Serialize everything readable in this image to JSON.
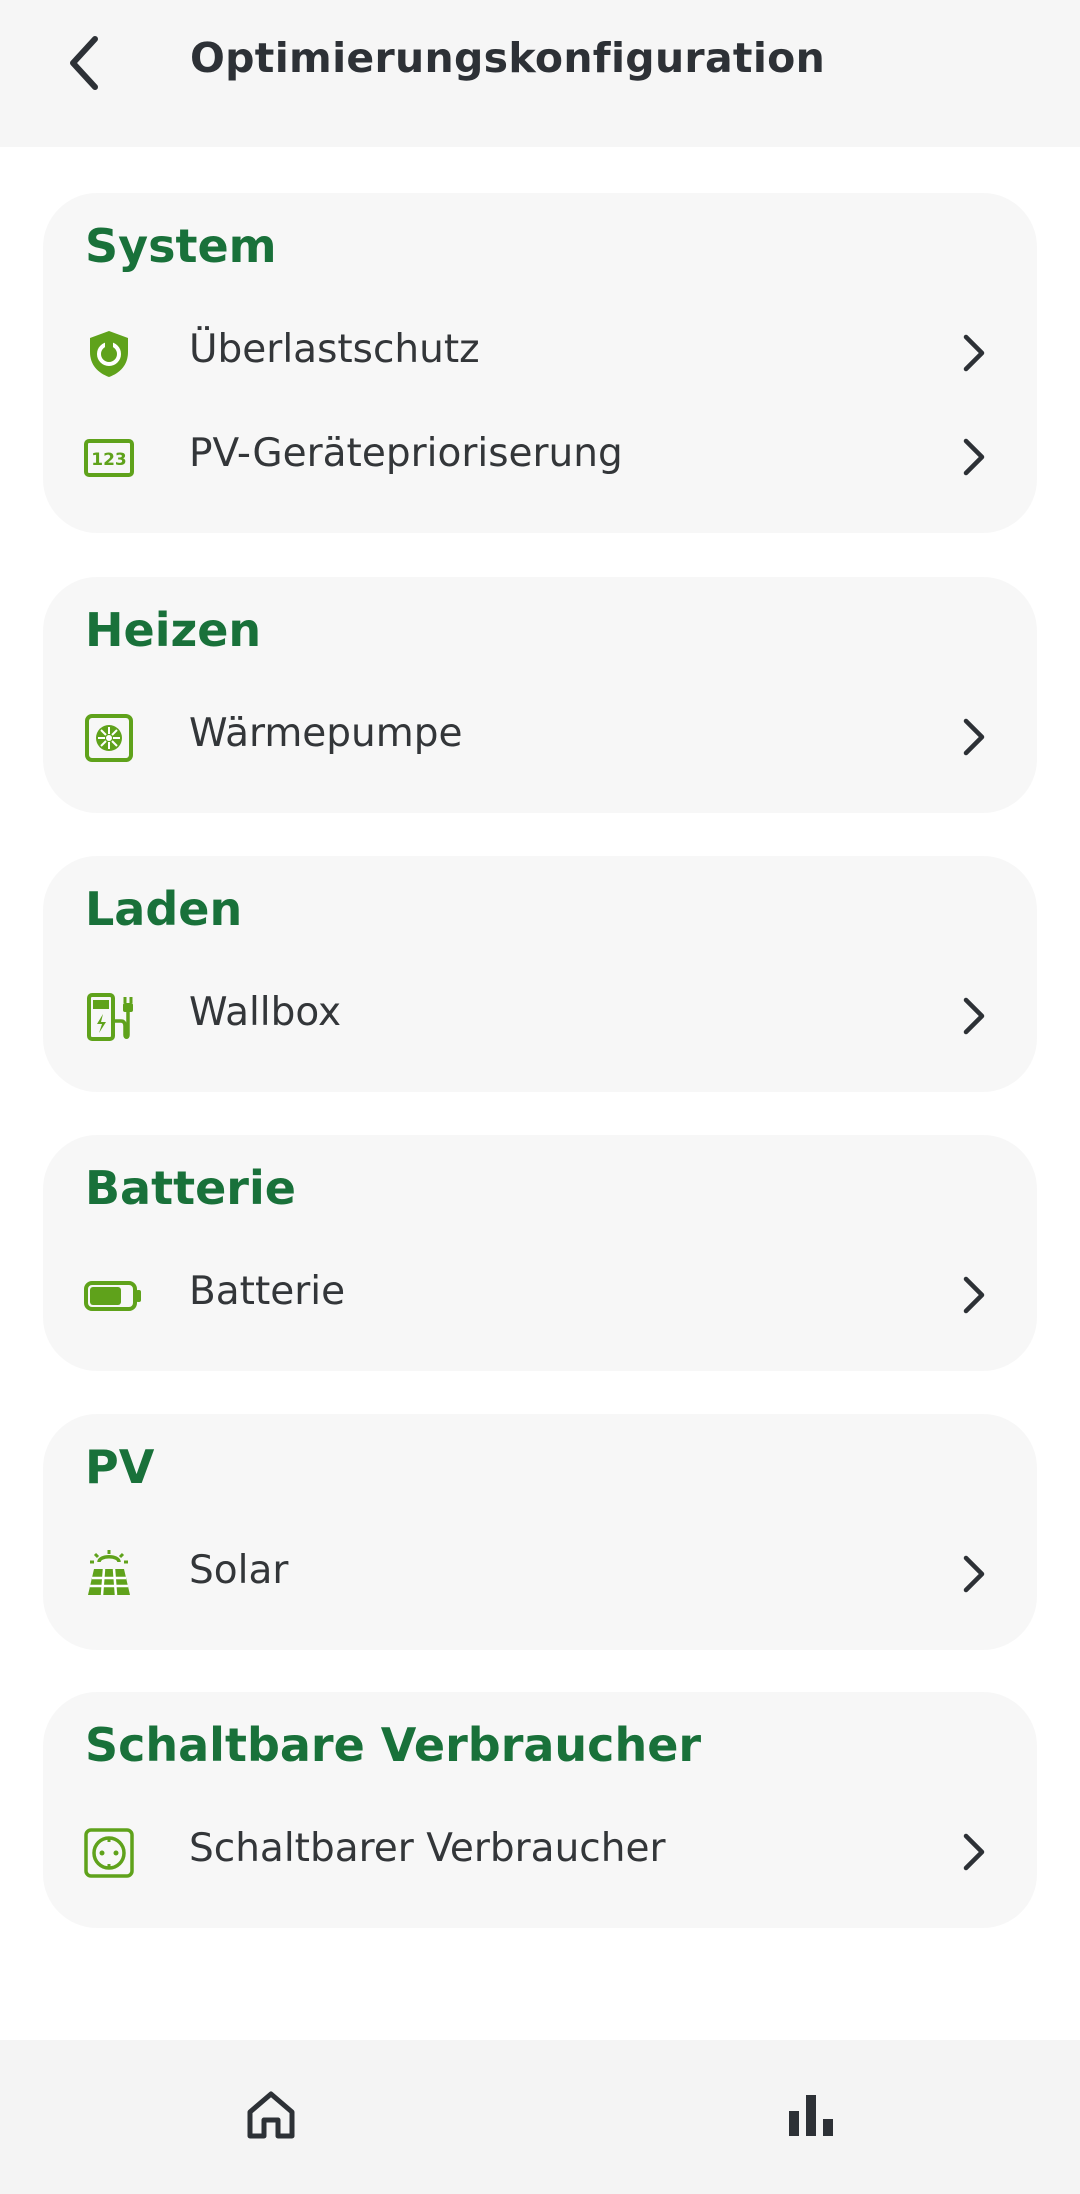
{
  "header": {
    "title": "Optimierungskonfiguration",
    "back_icon": "arrow-left-icon"
  },
  "sections": [
    {
      "title": "System",
      "items": [
        {
          "label": "Überlastschutz",
          "icon": "shield-icon"
        },
        {
          "label": "PV-Geräteprioriserung",
          "icon": "numbers-123-icon"
        }
      ]
    },
    {
      "title": "Heizen",
      "items": [
        {
          "label": "Wärmepumpe",
          "icon": "heat-pump-icon"
        }
      ]
    },
    {
      "title": "Laden",
      "items": [
        {
          "label": "Wallbox",
          "icon": "ev-charger-icon"
        }
      ]
    },
    {
      "title": "Batterie",
      "items": [
        {
          "label": "Batterie",
          "icon": "battery-icon"
        }
      ]
    },
    {
      "title": "PV",
      "items": [
        {
          "label": "Solar",
          "icon": "solar-panel-icon"
        }
      ]
    },
    {
      "title": "Schaltbare Verbraucher",
      "items": [
        {
          "label": "Schaltbarer Verbraucher",
          "icon": "power-socket-icon"
        }
      ]
    }
  ],
  "bottom_nav": {
    "items": [
      {
        "icon": "home-icon"
      },
      {
        "icon": "bar-chart-icon"
      }
    ]
  },
  "colors": {
    "accent_green": "#19713a",
    "icon_green": "#5fa21b",
    "card_background": "#f7f7f7",
    "header_background": "#f6f6f6"
  }
}
